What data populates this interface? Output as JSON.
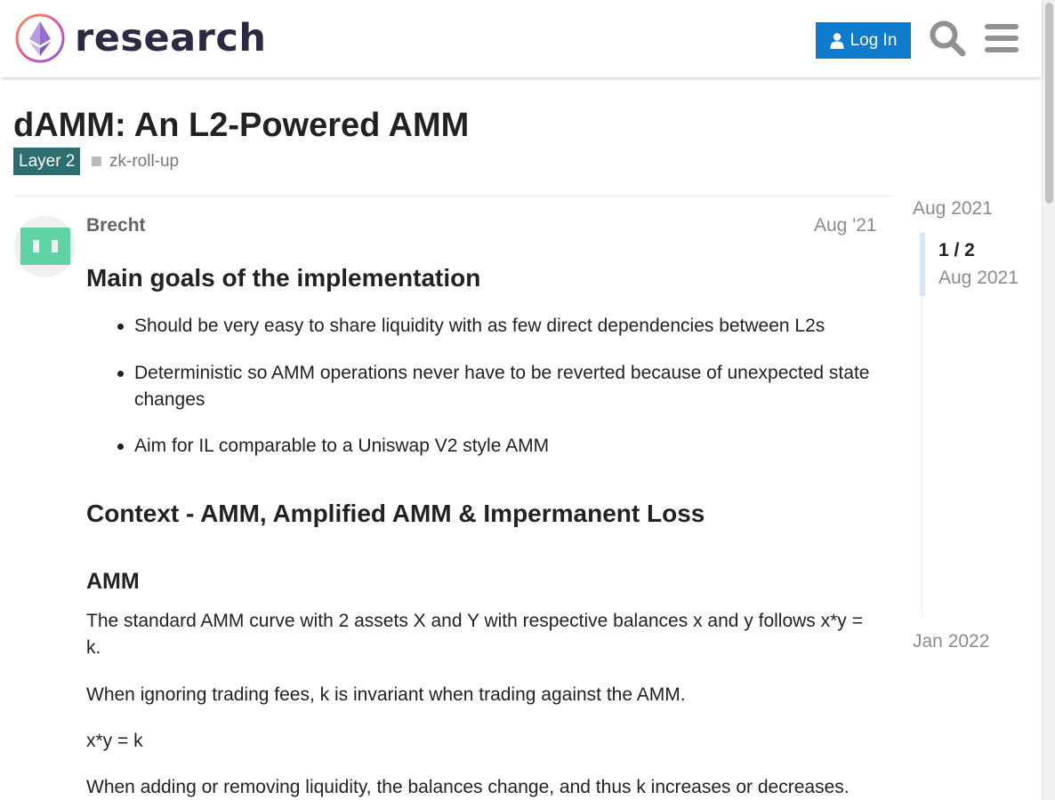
{
  "header": {
    "site_name": "research",
    "login_label": "Log In",
    "search_icon": "search-icon",
    "menu_icon": "hamburger-menu-icon"
  },
  "topic": {
    "title": "dAMM: An L2-Powered AMM",
    "category": "Layer 2",
    "category_color": "#2c6e6f",
    "tag": "zk-roll-up"
  },
  "post": {
    "author": "Brecht",
    "date": "Aug '21",
    "heading_goals": "Main goals of the implementation",
    "goals": [
      "Should be very easy to share liquidity with as few direct dependencies between L2s",
      "Deterministic so AMM operations never have to be reverted because of unexpected state changes",
      "Aim for IL comparable to a Uniswap V2 style AMM"
    ],
    "heading_context": "Context - AMM, Amplified AMM & Impermanent Loss",
    "heading_amm": "AMM",
    "para_curve": "The standard AMM curve with 2 assets X and Y with respective balances x and y follows x*y = k.",
    "para_invariant": "When ignoring trading fees, k is invariant when trading against the AMM.",
    "para_formula": "x*y = k",
    "para_liquidity": "When adding or removing liquidity, the balances change, and thus k increases or decreases."
  },
  "timeline": {
    "start": "Aug 2021",
    "position": "1 / 2",
    "position_date": "Aug 2021",
    "end": "Jan 2022"
  },
  "colors": {
    "accent": "#0e7bcd",
    "avatar_green": "#5fd3a3"
  }
}
